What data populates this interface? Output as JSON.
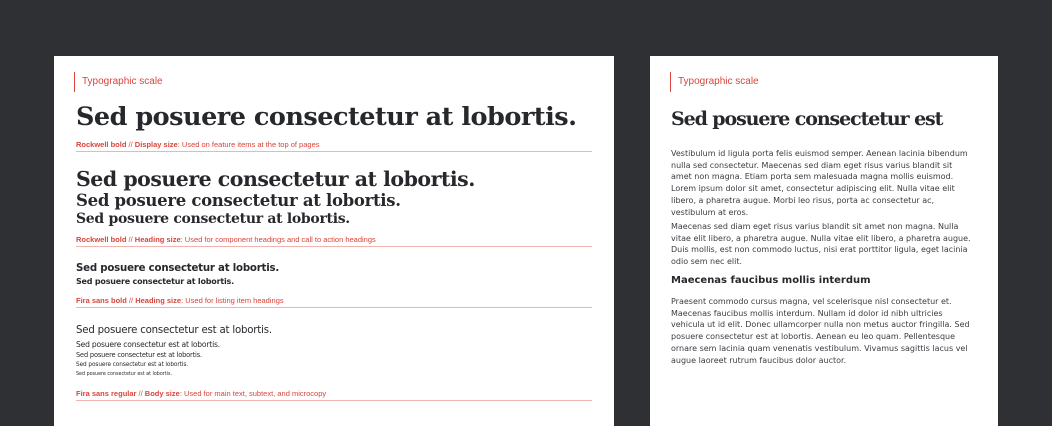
{
  "left_card": {
    "label": "Typographic scale",
    "display": {
      "sample": "Sed posuere consectetur at lobortis.",
      "caption_font": "Rockwell bold",
      "caption_sep": " // ",
      "caption_size": "Display size",
      "caption_desc": ": Used on feature items at the top of pages"
    },
    "heading": {
      "samples": [
        "Sed posuere consectetur at lobortis.",
        "Sed posuere consectetur at lobortis.",
        "Sed posuere consectetur at lobortis."
      ],
      "caption_font": "Rockwell bold",
      "caption_sep": " // ",
      "caption_size": "Heading size",
      "caption_desc": ": Used for component headings and call to action headings"
    },
    "fira_heading": {
      "samples": [
        "Sed posuere consectetur at lobortis.",
        "Sed posuere consectetur at lobortis."
      ],
      "caption_font": "Fira sans bold",
      "caption_sep": " // ",
      "caption_size": "Heading size",
      "caption_desc": ": Used for listing item headings"
    },
    "body": {
      "samples": [
        "Sed posuere consectetur est at lobortis.",
        "Sed posuere consectetur est at lobortis.",
        "Sed posuere consectetur est at lobortis.",
        "Sed posuere consectetur est at lobortis.",
        "Sed posuere consectetur est at lobortis."
      ],
      "caption_font": "Fira sans regular",
      "caption_sep": " // ",
      "caption_size": "Body size",
      "caption_desc": ": Used for main text, subtext, and microcopy"
    }
  },
  "right_card": {
    "label": "Typographic scale",
    "title": "Sed posuere consectetur est",
    "paragraphs": [
      "Vestibulum id ligula porta felis euismod semper. Aenean lacinia bibendum nulla sed consectetur. Maecenas sed diam eget risus varius blandit sit amet non magna. Etiam porta sem malesuada magna mollis euismod. Lorem ipsum dolor sit amet, consectetur adipiscing elit. Nulla vitae elit libero, a pharetra augue. Morbi leo risus, porta ac consectetur ac, vestibulum at eros.",
      "Maecenas sed diam eget risus varius blandit sit amet non magna. Nulla vitae elit libero, a pharetra augue. Nulla vitae elit libero, a pharetra augue. Duis mollis, est non commodo luctus, nisi erat porttitor ligula, eget lacinia odio sem nec elit.",
      "Praesent commodo cursus magna, vel scelerisque nisl consectetur et. Maecenas faucibus mollis interdum. Nullam id dolor id nibh ultricies vehicula ut id elit. Donec ullamcorper nulla non metus auctor fringilla. Sed posuere consectetur est at lobortis. Aenean eu leo quam. Pellentesque ornare sem lacinia quam venenatis vestibulum. Vivamus sagittis lacus vel augue laoreet rutrum faucibus dolor auctor."
    ],
    "subheading": "Maecenas faucibus mollis interdum"
  },
  "colors": {
    "background": "#2f3033",
    "card": "#ffffff",
    "accent": "#d9443a",
    "text": "#26282c"
  }
}
